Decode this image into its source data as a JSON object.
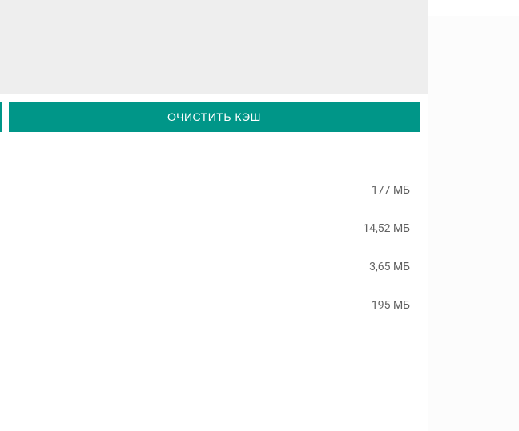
{
  "button": {
    "clear_cache_label": "ОЧИСТИТЬ КЭШ"
  },
  "storage": {
    "items": [
      {
        "value": "177 МБ"
      },
      {
        "value": "14,52 МБ"
      },
      {
        "value": "3,65 МБ"
      },
      {
        "value": "195 МБ"
      }
    ]
  }
}
